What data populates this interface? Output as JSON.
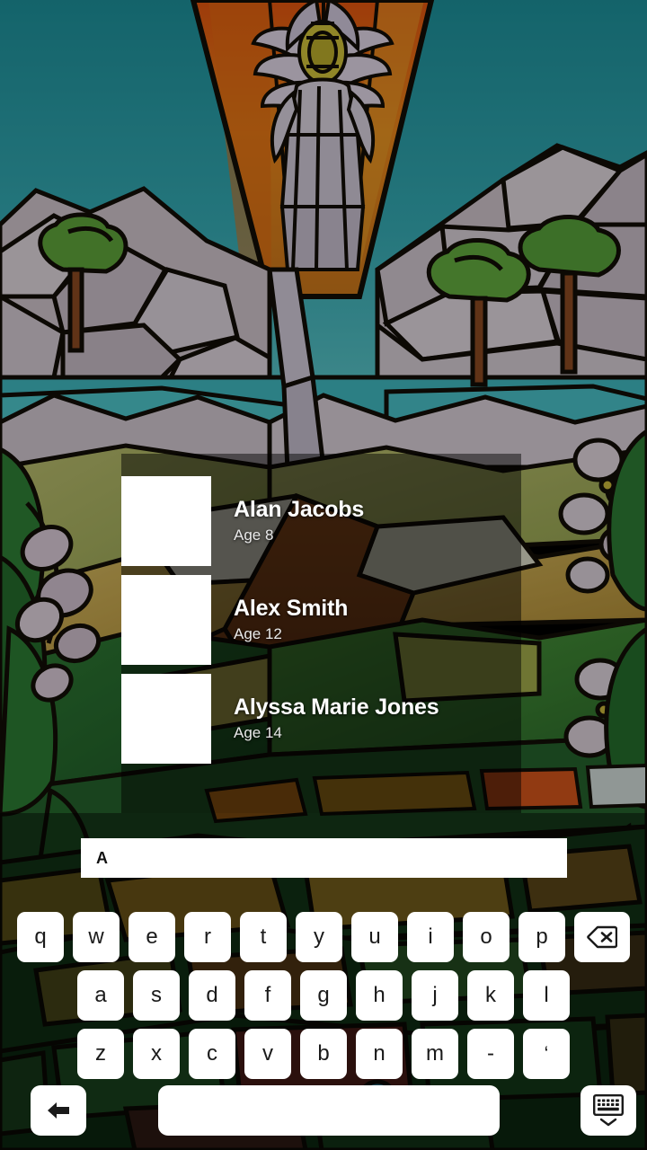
{
  "wallpaper": {
    "description": "stained-glass-angel-landscape",
    "dim_overlay_color": "#000000"
  },
  "profiles": {
    "panel_overlay_color": "#000000",
    "items": [
      {
        "name": "Alan Jacobs",
        "age_label": "Age 8",
        "thumbnail": "blank-avatar-thumbnail"
      },
      {
        "name": "Alex Smith",
        "age_label": "Age 12",
        "thumbnail": "blank-avatar-thumbnail"
      },
      {
        "name": "Alyssa Marie Jones",
        "age_label": "Age 14",
        "thumbnail": "blank-avatar-thumbnail"
      }
    ]
  },
  "search": {
    "value": "A",
    "placeholder": ""
  },
  "keyboard": {
    "row1": [
      {
        "label": "q",
        "name": "key-q"
      },
      {
        "label": "w",
        "name": "key-w"
      },
      {
        "label": "e",
        "name": "key-e"
      },
      {
        "label": "r",
        "name": "key-r"
      },
      {
        "label": "t",
        "name": "key-t"
      },
      {
        "label": "y",
        "name": "key-y"
      },
      {
        "label": "u",
        "name": "key-u"
      },
      {
        "label": "i",
        "name": "key-i"
      },
      {
        "label": "o",
        "name": "key-o"
      },
      {
        "label": "p",
        "name": "key-p"
      }
    ],
    "row2": [
      {
        "label": "a",
        "name": "key-a"
      },
      {
        "label": "s",
        "name": "key-s"
      },
      {
        "label": "d",
        "name": "key-d"
      },
      {
        "label": "f",
        "name": "key-f"
      },
      {
        "label": "g",
        "name": "key-g"
      },
      {
        "label": "h",
        "name": "key-h"
      },
      {
        "label": "j",
        "name": "key-j"
      },
      {
        "label": "k",
        "name": "key-k"
      },
      {
        "label": "l",
        "name": "key-l"
      }
    ],
    "row3": [
      {
        "label": "z",
        "name": "key-z"
      },
      {
        "label": "x",
        "name": "key-x"
      },
      {
        "label": "c",
        "name": "key-c"
      },
      {
        "label": "v",
        "name": "key-v"
      },
      {
        "label": "b",
        "name": "key-b"
      },
      {
        "label": "n",
        "name": "key-n"
      },
      {
        "label": "m",
        "name": "key-m"
      },
      {
        "label": "-",
        "name": "key-hyphen"
      },
      {
        "label": "‘",
        "name": "key-apostrophe"
      }
    ],
    "backspace": {
      "icon": "backspace-icon",
      "label": ""
    },
    "back": {
      "icon": "back-arrow-icon",
      "label": ""
    },
    "space": {
      "label": "",
      "name": "key-space"
    },
    "hide": {
      "icon": "hide-keyboard-icon",
      "label": ""
    }
  }
}
